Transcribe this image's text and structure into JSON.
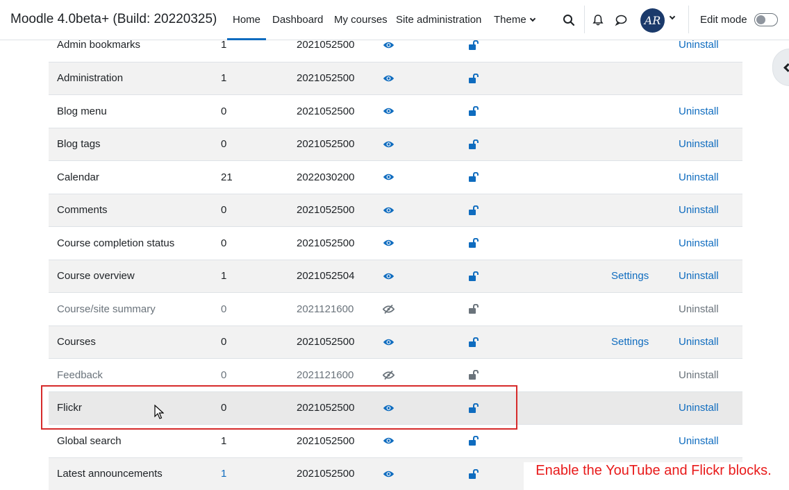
{
  "navbar": {
    "brand": "Moodle 4.0beta+ (Build: 20220325)",
    "items": [
      {
        "label": "Home",
        "active": true
      },
      {
        "label": "Dashboard",
        "active": false
      },
      {
        "label": "My courses",
        "active": false
      },
      {
        "label": "Site administration",
        "active": false
      },
      {
        "label": "Theme",
        "active": false
      }
    ],
    "avatar_initials": "AR",
    "edit_mode_label": "Edit mode",
    "edit_mode_on": false
  },
  "icons": [
    "search-icon",
    "bell-icon",
    "chat-icon",
    "chevron-down-icon",
    "eye-icon",
    "eye-slash-icon",
    "unlock-icon",
    "chevron-left-icon"
  ],
  "colors": {
    "link": "#0f6cbf",
    "muted": "#6a737b",
    "highlight": "#d62a2a",
    "annotation": "#e81a1a"
  },
  "blocks": [
    {
      "name": "Admin bookmarks",
      "instances": "1",
      "version": "2021052500",
      "enabled": true,
      "settings": "",
      "uninstall": "Uninstall"
    },
    {
      "name": "Administration",
      "instances": "1",
      "version": "2021052500",
      "enabled": true,
      "settings": "",
      "uninstall": ""
    },
    {
      "name": "Blog menu",
      "instances": "0",
      "version": "2021052500",
      "enabled": true,
      "settings": "",
      "uninstall": "Uninstall"
    },
    {
      "name": "Blog tags",
      "instances": "0",
      "version": "2021052500",
      "enabled": true,
      "settings": "",
      "uninstall": "Uninstall"
    },
    {
      "name": "Calendar",
      "instances": "21",
      "version": "2022030200",
      "enabled": true,
      "settings": "",
      "uninstall": "Uninstall"
    },
    {
      "name": "Comments",
      "instances": "0",
      "version": "2021052500",
      "enabled": true,
      "settings": "",
      "uninstall": "Uninstall"
    },
    {
      "name": "Course completion status",
      "instances": "0",
      "version": "2021052500",
      "enabled": true,
      "settings": "",
      "uninstall": "Uninstall"
    },
    {
      "name": "Course overview",
      "instances": "1",
      "version": "2021052504",
      "enabled": true,
      "settings": "Settings",
      "uninstall": "Uninstall"
    },
    {
      "name": "Course/site summary",
      "instances": "0",
      "version": "2021121600",
      "enabled": false,
      "settings": "",
      "uninstall": "Uninstall"
    },
    {
      "name": "Courses",
      "instances": "0",
      "version": "2021052500",
      "enabled": true,
      "settings": "Settings",
      "uninstall": "Uninstall"
    },
    {
      "name": "Feedback",
      "instances": "0",
      "version": "2021121600",
      "enabled": false,
      "settings": "",
      "uninstall": "Uninstall"
    },
    {
      "name": "Flickr",
      "instances": "0",
      "version": "2021052500",
      "enabled": true,
      "settings": "",
      "uninstall": "Uninstall"
    },
    {
      "name": "Global search",
      "instances": "1",
      "version": "2021052500",
      "enabled": true,
      "settings": "",
      "uninstall": "Uninstall"
    },
    {
      "name": "Latest announcements",
      "instances": "1",
      "version": "2021052500",
      "enabled": true,
      "settings": "",
      "uninstall": "",
      "instances_link": true
    }
  ],
  "annotation": "Enable the YouTube and Flickr blocks."
}
